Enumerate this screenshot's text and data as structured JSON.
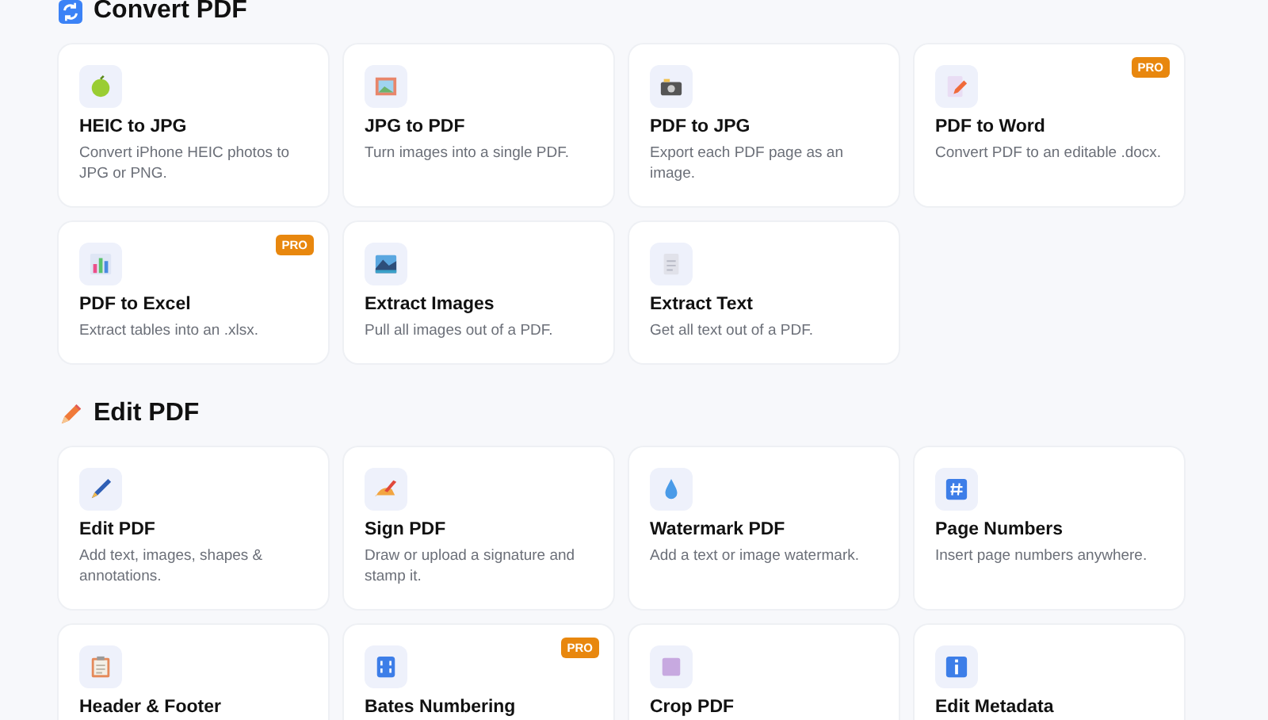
{
  "sections": [
    {
      "title": "Convert PDF",
      "kind": "convert",
      "tools": [
        {
          "name": "HEIC to JPG",
          "description": "Convert iPhone HEIC photos to JPG or PNG.",
          "pro": false
        },
        {
          "name": "JPG to PDF",
          "description": "Turn images into a single PDF.",
          "pro": false
        },
        {
          "name": "PDF to JPG",
          "description": "Export each PDF page as an image.",
          "pro": false
        },
        {
          "name": "PDF to Word",
          "description": "Convert PDF to an editable .docx.",
          "pro": true,
          "badge": "PRO"
        },
        {
          "name": "PDF to Excel",
          "description": "Extract tables into an .xlsx.",
          "pro": true,
          "badge": "PRO"
        },
        {
          "name": "Extract Images",
          "description": "Pull all images out of a PDF.",
          "pro": false
        },
        {
          "name": "Extract Text",
          "description": "Get all text out of a PDF.",
          "pro": false
        }
      ]
    },
    {
      "title": "Edit PDF",
      "kind": "edit",
      "tools": [
        {
          "name": "Edit PDF",
          "description": "Add text, images, shapes & annotations.",
          "pro": false
        },
        {
          "name": "Sign PDF",
          "description": "Draw or upload a signature and stamp it.",
          "pro": false
        },
        {
          "name": "Watermark PDF",
          "description": "Add a text or image watermark.",
          "pro": false
        },
        {
          "name": "Page Numbers",
          "description": "Insert page numbers anywhere.",
          "pro": false
        },
        {
          "name": "Header & Footer",
          "pro": false
        },
        {
          "name": "Bates Numbering",
          "pro": true,
          "badge": "PRO"
        },
        {
          "name": "Crop PDF",
          "pro": false
        },
        {
          "name": "Edit Metadata",
          "pro": false
        }
      ]
    }
  ]
}
